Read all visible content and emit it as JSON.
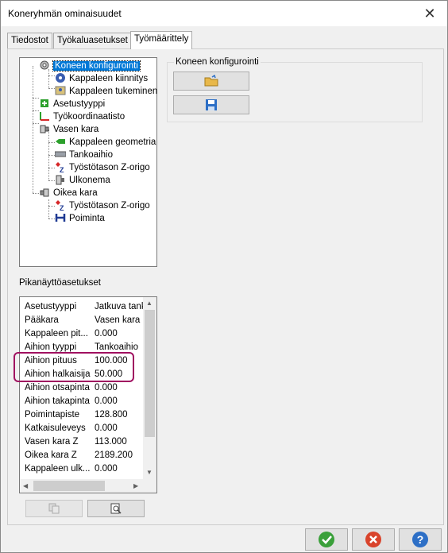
{
  "window": {
    "title": "Koneryhmän ominaisuudet"
  },
  "tabs": [
    {
      "label": "Tiedostot"
    },
    {
      "label": "Työkaluasetukset"
    },
    {
      "label": "Työmäärittely"
    }
  ],
  "tree": [
    {
      "label": "Koneen konfigurointi",
      "icon": "gear-icon",
      "selected": true
    },
    {
      "label": "Kappaleen kiinnitys",
      "icon": "chuck-icon"
    },
    {
      "label": "Kappaleen tukeminen",
      "icon": "support-icon"
    },
    {
      "label": "Asetustyyppi",
      "icon": "setup-type-icon"
    },
    {
      "label": "Työkoordinaatisto",
      "icon": "axes-icon"
    },
    {
      "label": "Vasen kara",
      "icon": "spindle-icon"
    },
    {
      "label": "Kappaleen geometria",
      "icon": "geometry-icon"
    },
    {
      "label": "Tankoaihio",
      "icon": "bar-stock-icon"
    },
    {
      "label": "Työstötason Z-origo",
      "icon": "z-origin-icon"
    },
    {
      "label": "Ulkonema",
      "icon": "overhang-icon"
    },
    {
      "label": "Oikea kara",
      "icon": "spindle-icon"
    },
    {
      "label": "Työstötason Z-origo",
      "icon": "z-origin-icon"
    },
    {
      "label": "Poiminta",
      "icon": "pickoff-icon"
    }
  ],
  "config_group": {
    "label": "Koneen konfigurointi"
  },
  "quick_view": {
    "label": "Pikanäyttöasetukset",
    "rows": [
      {
        "name": "Asetustyyppi",
        "value": "Jatkuva tank"
      },
      {
        "name": "Pääkara",
        "value": "Vasen kara"
      },
      {
        "name": "Kappaleen pit...",
        "value": "0.000"
      },
      {
        "name": "Aihion tyyppi",
        "value": "Tankoaihio"
      },
      {
        "name": "Aihion pituus",
        "value": "100.000"
      },
      {
        "name": "Aihion halkaisija",
        "value": "50.000"
      },
      {
        "name": "Aihion otsapinta",
        "value": "0.000"
      },
      {
        "name": "Aihion takapinta",
        "value": "0.000"
      },
      {
        "name": "Poimintapiste",
        "value": "128.800"
      },
      {
        "name": "Katkaisuleveys",
        "value": "0.000"
      },
      {
        "name": "Vasen kara Z",
        "value": "113.000"
      },
      {
        "name": "Oikea kara Z",
        "value": "2189.200"
      },
      {
        "name": "Kappaleen ulk...",
        "value": "0.000"
      }
    ]
  },
  "colors": {
    "ok": "#3aa03a",
    "cancel": "#d9442c",
    "help": "#2d6fc6",
    "highlight": "#a01060"
  }
}
